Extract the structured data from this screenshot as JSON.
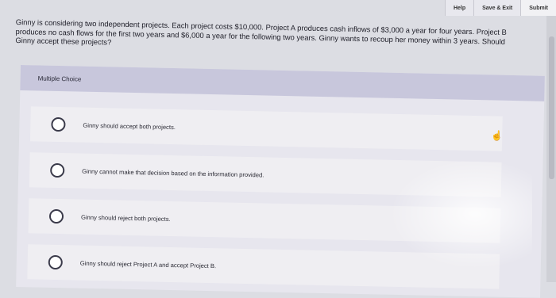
{
  "toolbar": {
    "help_label": "Help",
    "save_exit_label": "Save & Exit",
    "submit_label": "Submit"
  },
  "question": {
    "text": "Ginny is considering two independent projects. Each project costs $10,000. Project A produces cash inflows of $3,000 a year for four years. Project B produces no cash flows for the first two years and $6,000 a year for the following two years. Ginny wants to recoup her money within 3 years. Should Ginny accept these projects?"
  },
  "choices": {
    "header": "Multiple Choice",
    "options": [
      "Ginny should accept both projects.",
      "Ginny cannot make that decision based on the information provided.",
      "Ginny should reject both projects.",
      "Ginny should reject Project A and accept Project B."
    ]
  }
}
